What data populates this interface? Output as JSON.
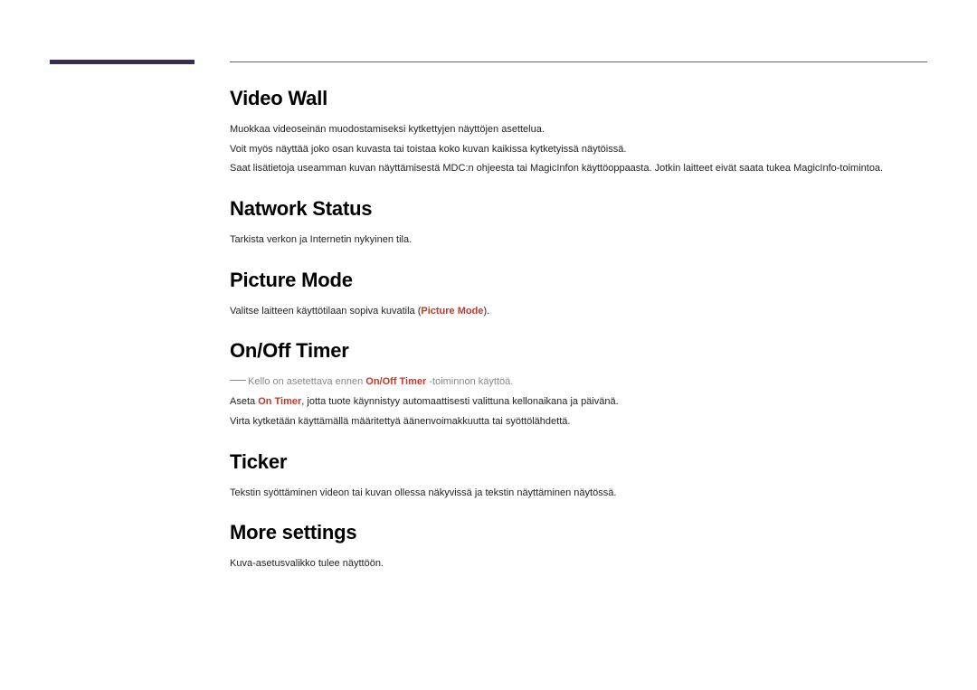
{
  "sections": {
    "videoWall": {
      "heading": "Video Wall",
      "p1": "Muokkaa videoseinän muodostamiseksi kytkettyjen näyttöjen asettelua.",
      "p2": "Voit myös näyttää joko osan kuvasta tai toistaa koko kuvan kaikissa kytketyissä näytöissä.",
      "p3": "Saat lisätietoja useamman kuvan näyttämisestä MDC:n ohjeesta tai MagicInfon käyttöoppaasta. Jotkin laitteet eivät saata tukea MagicInfo-toimintoa."
    },
    "networkStatus": {
      "heading": "Natwork Status",
      "p1": "Tarkista verkon ja Internetin nykyinen tila."
    },
    "pictureMode": {
      "heading": "Picture Mode",
      "p1_pre": "Valitse laitteen käyttötilaan sopiva kuvatila (",
      "p1_hl": "Picture Mode",
      "p1_post": ")."
    },
    "onOffTimer": {
      "heading": "On/Off Timer",
      "note_pre": "Kello on asetettava ennen ",
      "note_hl": "On/Off Timer",
      "note_post": " -toiminnon käyttöä.",
      "p2_pre": "Aseta ",
      "p2_hl": "On Timer",
      "p2_post": ", jotta tuote käynnistyy automaattisesti valittuna kellonaikana ja päivänä.",
      "p3": "Virta kytketään käyttämällä määritettyä äänenvoimakkuutta tai syöttölähdettä."
    },
    "ticker": {
      "heading": "Ticker",
      "p1": "Tekstin syöttäminen videon tai kuvan ollessa näkyvissä ja tekstin näyttäminen näytössä."
    },
    "moreSettings": {
      "heading": "More settings",
      "p1": "Kuva-asetusvalikko tulee näyttöön."
    }
  }
}
